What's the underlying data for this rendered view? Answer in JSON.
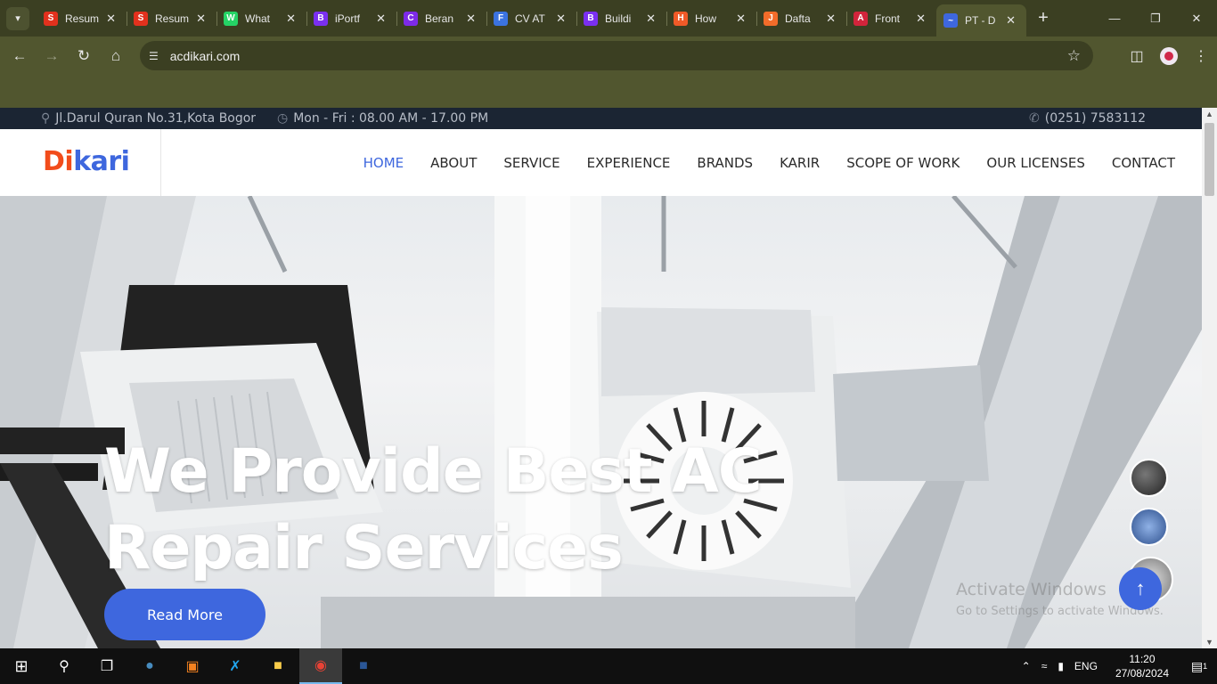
{
  "browser": {
    "tabs": [
      {
        "title": "Resum",
        "icon": "S",
        "color": "#e2311d"
      },
      {
        "title": "Resum",
        "icon": "S",
        "color": "#e2311d"
      },
      {
        "title": "What",
        "icon": "W",
        "color": "#25d366"
      },
      {
        "title": "iPortf",
        "icon": "B",
        "color": "#7a2ff0"
      },
      {
        "title": "Beran",
        "icon": "C",
        "color": "#7d2ae8"
      },
      {
        "title": "CV AT",
        "icon": "F",
        "color": "#3b73e0"
      },
      {
        "title": "Buildi",
        "icon": "B",
        "color": "#7a2ff0"
      },
      {
        "title": "How",
        "icon": "H",
        "color": "#f05a28"
      },
      {
        "title": "Dafta",
        "icon": "J",
        "color": "#f26c2a"
      },
      {
        "title": "Front",
        "icon": "A",
        "color": "#d2243b"
      },
      {
        "title": "PT - D",
        "icon": "~",
        "color": "#3e67de"
      }
    ],
    "url": "acdikari.com"
  },
  "topbar": {
    "address": "Jl.Darul Quran No.31,Kota Bogor",
    "hours": "Mon - Fri : 08.00 AM - 17.00 PM",
    "phone": "(0251) 7583112"
  },
  "logo": {
    "part1": "Di",
    "part2": "kari"
  },
  "nav": {
    "items": [
      "HOME",
      "ABOUT",
      "SERVICE",
      "EXPERIENCE",
      "BRANDS",
      "KARIR",
      "SCOPE OF WORK",
      "OUR LICENSES",
      "CONTACT"
    ],
    "active": "HOME"
  },
  "hero": {
    "title": "We Provide Best AC Repair Services",
    "button": "Read More"
  },
  "watermark": {
    "line1": "Activate Windows",
    "line2": "Go to Settings to activate Windows."
  },
  "taskbar": {
    "lang": "ENG",
    "time": "11:20",
    "date": "27/08/2024",
    "notifications": "1"
  },
  "colors": {
    "brand_blue": "#3e67de",
    "brand_orange": "#f24c1b",
    "topbar": "#1b2533"
  }
}
